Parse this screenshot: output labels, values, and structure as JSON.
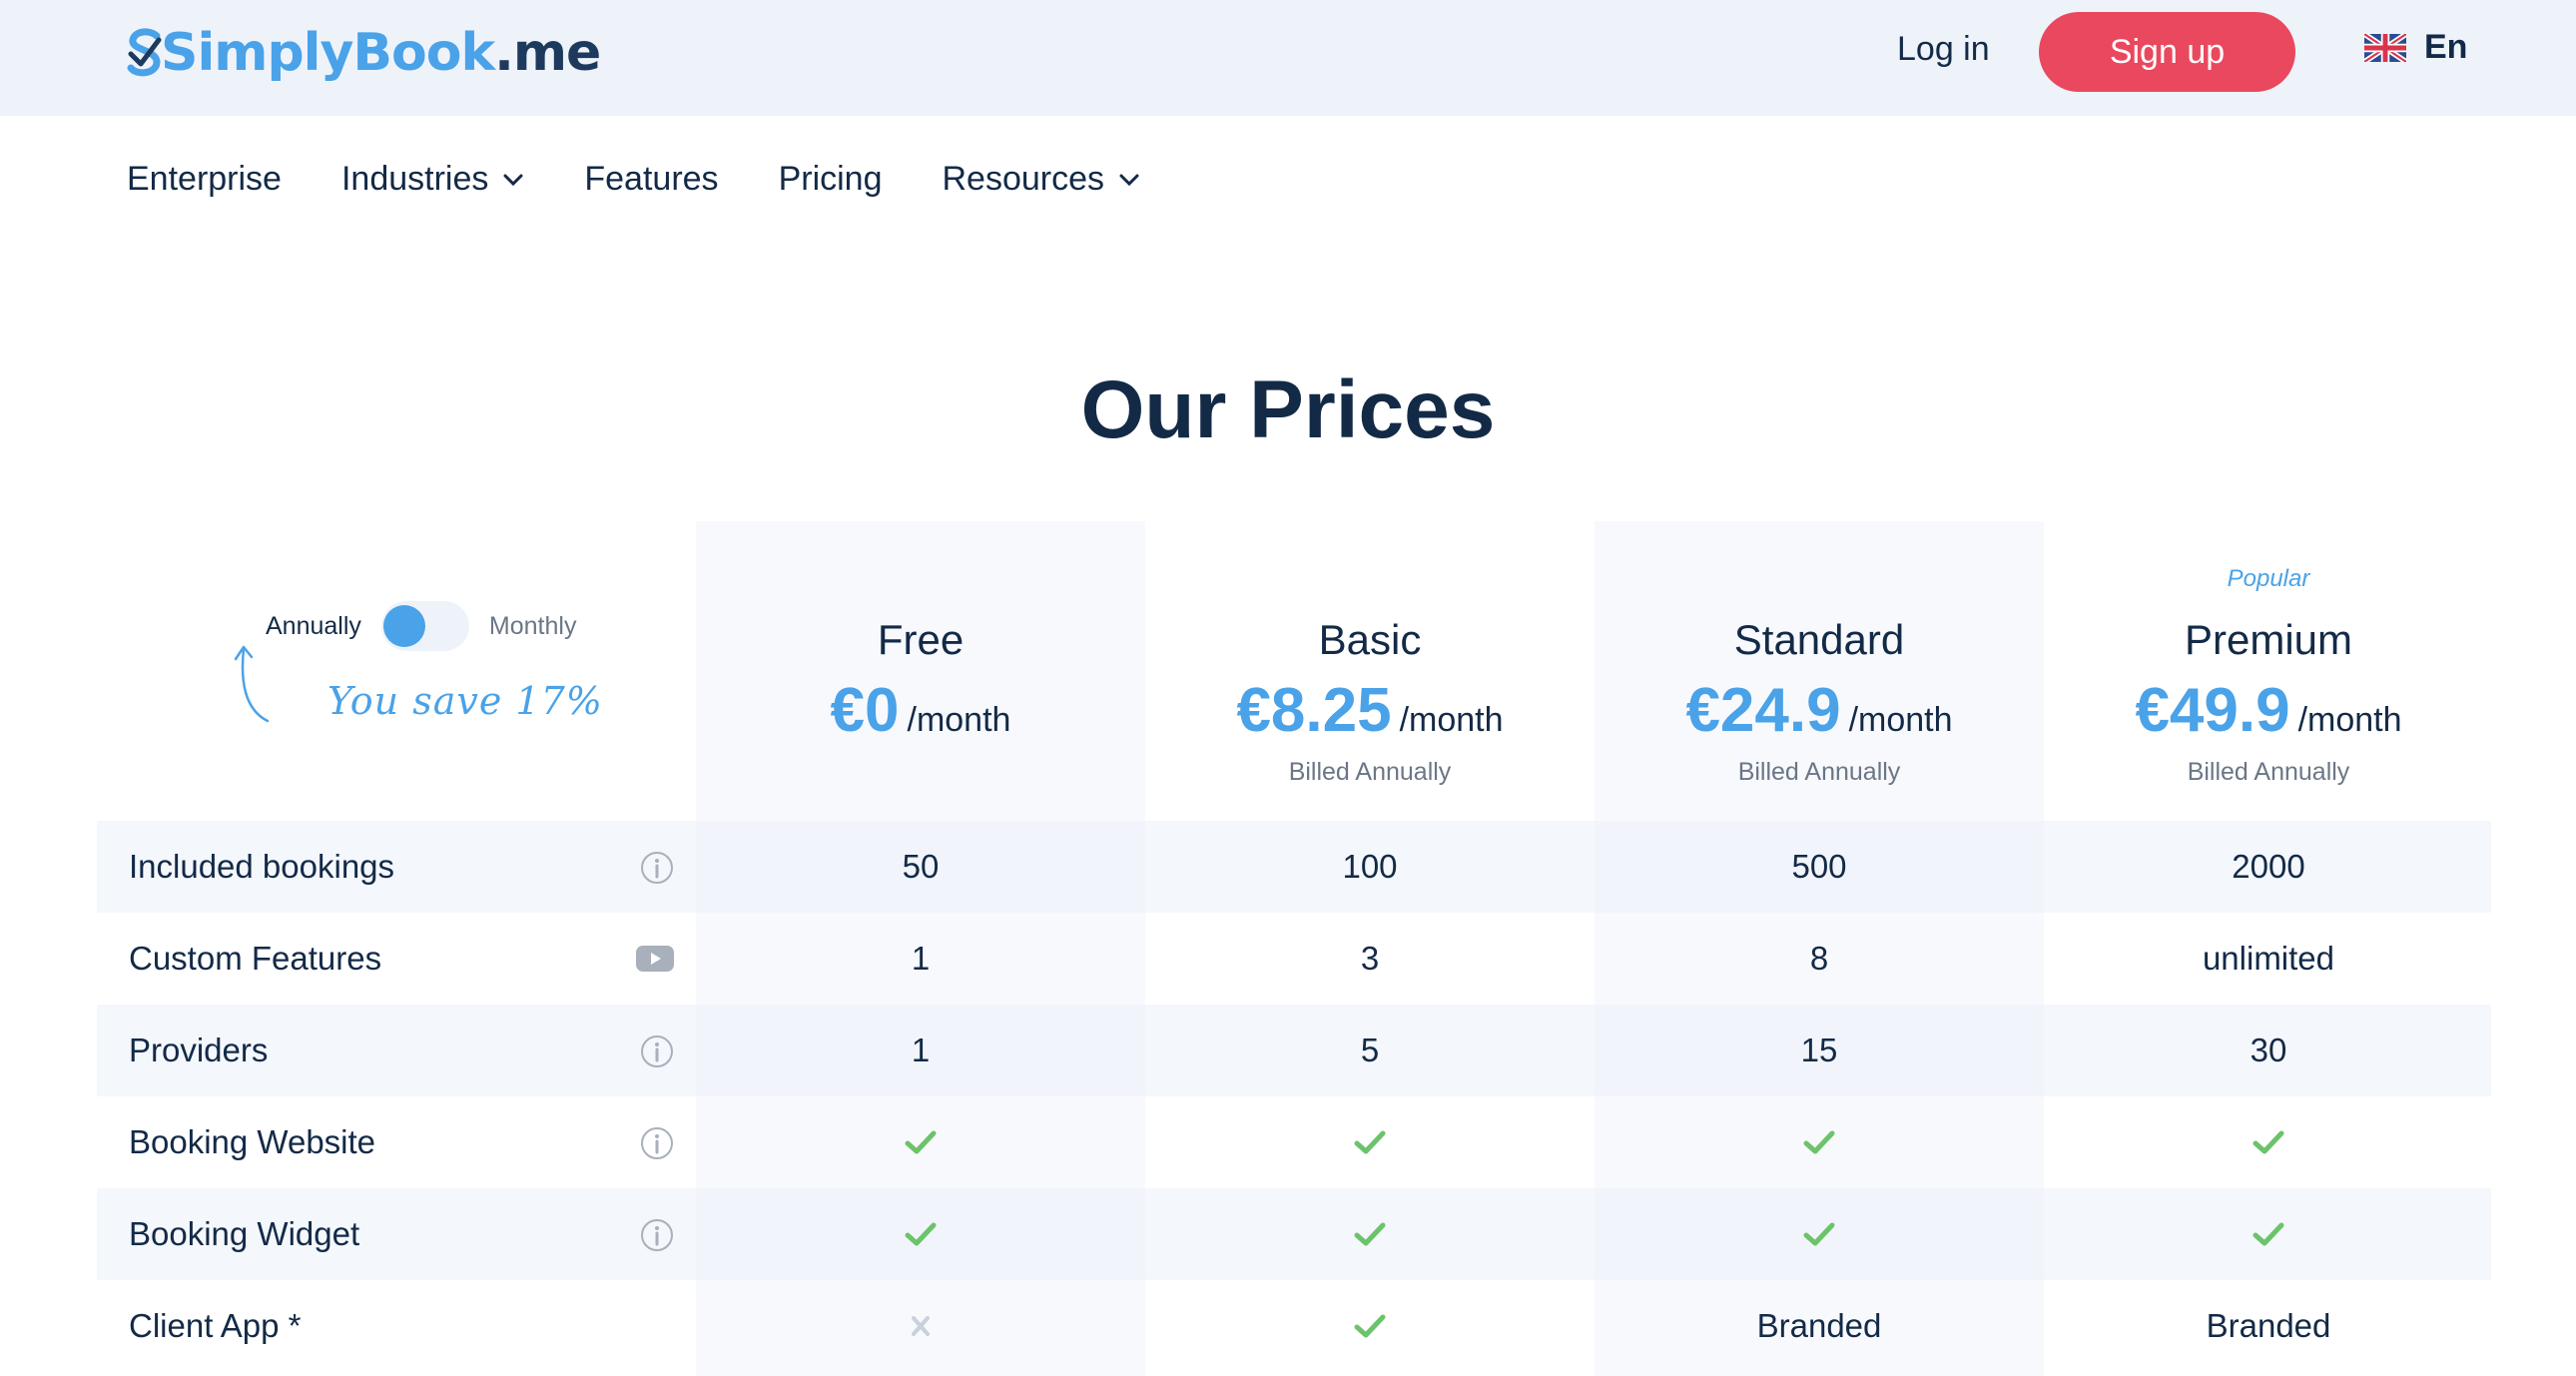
{
  "header": {
    "logo_part1": "Simply",
    "logo_part2": "Book",
    "logo_part3": ".me",
    "login_label": "Log in",
    "signup_label": "Sign up",
    "language_label": "En"
  },
  "nav": {
    "items": [
      {
        "label": "Enterprise"
      },
      {
        "label": "Industries"
      },
      {
        "label": "Features"
      },
      {
        "label": "Pricing"
      },
      {
        "label": "Resources"
      }
    ]
  },
  "page_title": "Our Prices",
  "billing_toggle": {
    "annually_label": "Annually",
    "monthly_label": "Monthly",
    "savings_note": "You save 17%",
    "selected": "Annually"
  },
  "plans": [
    {
      "name": "Free",
      "price": "€0",
      "period": "/month",
      "billed": "",
      "badge": ""
    },
    {
      "name": "Basic",
      "price": "€8.25",
      "period": "/month",
      "billed": "Billed Annually",
      "badge": ""
    },
    {
      "name": "Standard",
      "price": "€24.9",
      "period": "/month",
      "billed": "Billed Annually",
      "badge": ""
    },
    {
      "name": "Premium",
      "price": "€49.9",
      "period": "/month",
      "billed": "Billed Annually",
      "badge": "Popular"
    }
  ],
  "features": [
    {
      "label": "Included bookings",
      "icon": "info-icon",
      "values": [
        "50",
        "100",
        "500",
        "2000"
      ]
    },
    {
      "label": "Custom Features",
      "icon": "video-icon",
      "values": [
        "1",
        "3",
        "8",
        "unlimited"
      ]
    },
    {
      "label": "Providers",
      "icon": "info-icon",
      "values": [
        "1",
        "5",
        "15",
        "30"
      ]
    },
    {
      "label": "Booking Website",
      "icon": "info-icon",
      "values": [
        "check",
        "check",
        "check",
        "check"
      ]
    },
    {
      "label": "Booking Widget",
      "icon": "info-icon",
      "values": [
        "check",
        "check",
        "check",
        "check"
      ]
    },
    {
      "label": "Client App *",
      "icon": "",
      "values": [
        "cross",
        "check",
        "Branded",
        "Branded"
      ]
    }
  ],
  "colors": {
    "accent_blue": "#4aa2e8",
    "signup_red": "#e9485e",
    "check_green": "#6cc36a",
    "text_dark": "#132a47"
  }
}
